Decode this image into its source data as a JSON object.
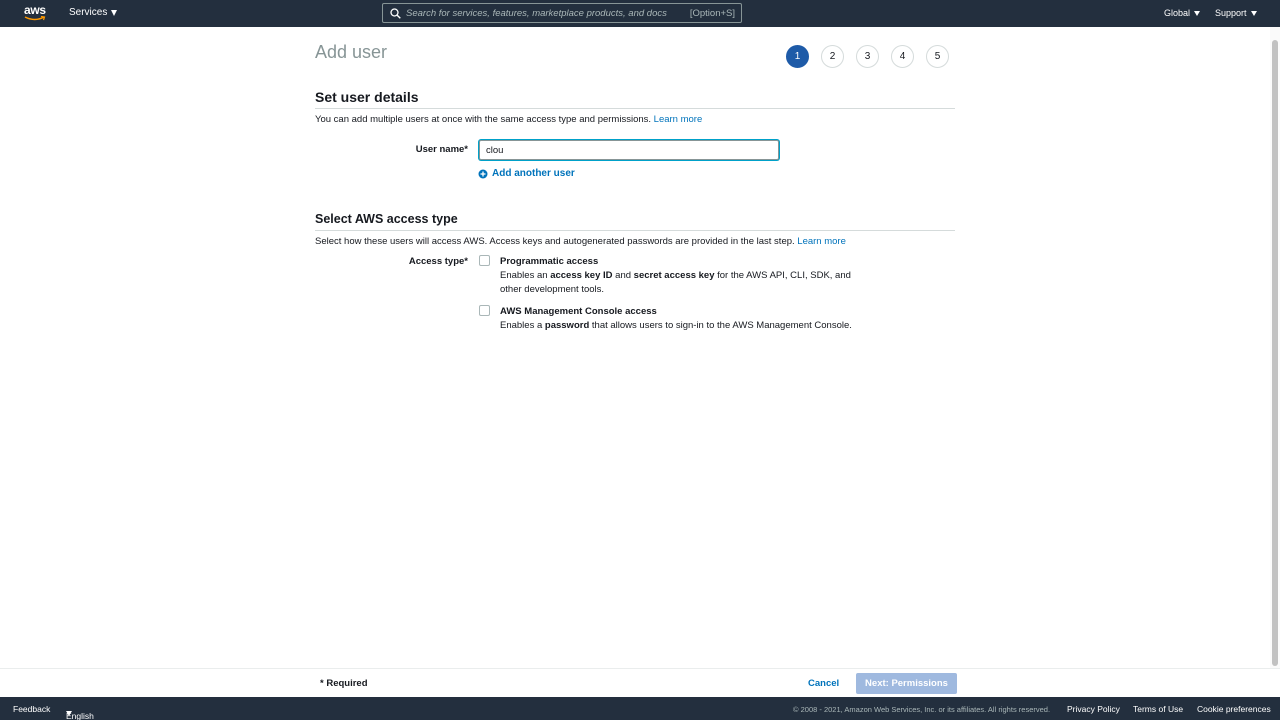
{
  "topnav": {
    "logo_text": "aws",
    "services_label": "Services",
    "search_placeholder": "Search for services, features, marketplace products, and docs",
    "search_shortcut": "[Option+S]",
    "region_label": "Global",
    "support_label": "Support"
  },
  "page": {
    "title": "Add user",
    "steps": [
      "1",
      "2",
      "3",
      "4",
      "5"
    ],
    "active_step": "1"
  },
  "user_details": {
    "title": "Set user details",
    "description": "You can add multiple users at once with the same access type and permissions.",
    "learn_more": "Learn more",
    "username_label": "User name*",
    "username_value": "clou",
    "add_another_user": "Add another user"
  },
  "access_type": {
    "title": "Select AWS access type",
    "description": "Select how these users will access AWS. Access keys and autogenerated passwords are provided in the last step.",
    "learn_more": "Learn more",
    "label": "Access type*",
    "programmatic": {
      "title": "Programmatic access",
      "desc_1": "Enables an ",
      "desc_bold_1": "access key ID",
      "desc_2": " and ",
      "desc_bold_2": "secret access key",
      "desc_3": " for the AWS API, CLI, SDK, and other development tools.",
      "checked": false
    },
    "console": {
      "title": "AWS Management Console access",
      "desc_1": "Enables a ",
      "desc_bold_1": "password",
      "desc_2": " that allows users to sign-in to the AWS Management Console.",
      "checked": false
    }
  },
  "actions": {
    "required_note": "* Required",
    "cancel": "Cancel",
    "next": "Next: Permissions"
  },
  "footer": {
    "feedback": "Feedback",
    "language": "English (US)",
    "copyright": "© 2008 - 2021, Amazon Web Services, Inc. or its affiliates. All rights reserved.",
    "privacy": "Privacy Policy",
    "terms": "Terms of Use",
    "cookies": "Cookie preferences"
  },
  "colors": {
    "nav_bg": "#232f3e",
    "link": "#0073bb",
    "active_step": "#1e5ba8",
    "primary_disabled": "#9fb9df"
  }
}
